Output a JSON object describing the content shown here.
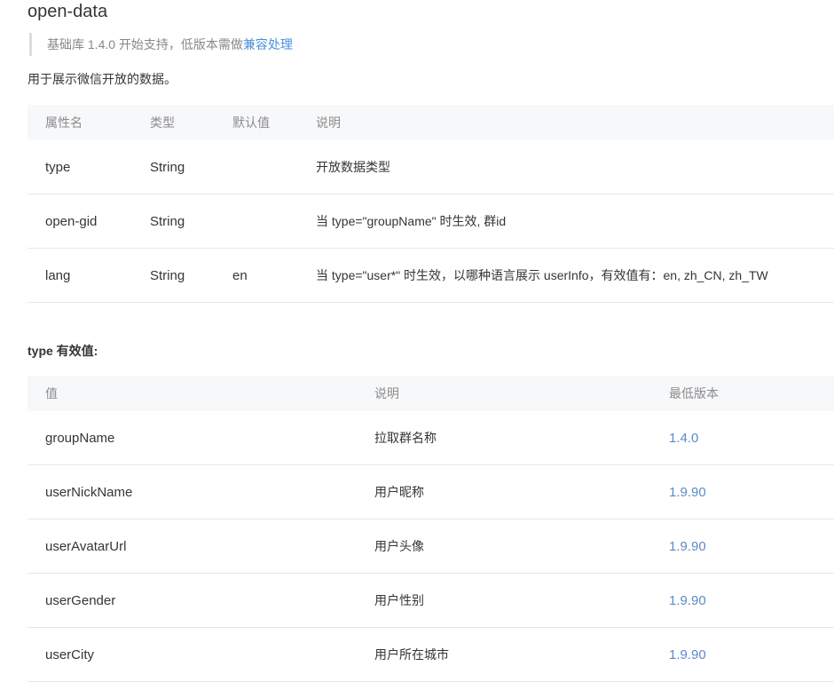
{
  "title": "open-data",
  "note": {
    "prefix": "基础库 1.4.0 开始支持，低版本需做",
    "link": "兼容处理"
  },
  "description": "用于展示微信开放的数据。",
  "attr_table": {
    "headers": [
      "属性名",
      "类型",
      "默认值",
      "说明"
    ],
    "rows": [
      {
        "name": "type",
        "type": "String",
        "default": "",
        "desc": "开放数据类型"
      },
      {
        "name": "open-gid",
        "type": "String",
        "default": "",
        "desc": "当 type=\"groupName\" 时生效, 群id"
      },
      {
        "name": "lang",
        "type": "String",
        "default": "en",
        "desc": "当 type=\"user*\" 时生效，以哪种语言展示 userInfo，有效值有：en, zh_CN, zh_TW"
      }
    ]
  },
  "type_section": {
    "heading": "type 有效值:"
  },
  "type_table": {
    "headers": [
      "值",
      "说明",
      "最低版本"
    ],
    "rows": [
      {
        "value": "groupName",
        "desc": "拉取群名称",
        "version": "1.4.0"
      },
      {
        "value": "userNickName",
        "desc": "用户昵称",
        "version": "1.9.90"
      },
      {
        "value": "userAvatarUrl",
        "desc": "用户头像",
        "version": "1.9.90"
      },
      {
        "value": "userGender",
        "desc": "用户性别",
        "version": "1.9.90"
      },
      {
        "value": "userCity",
        "desc": "用户所在城市",
        "version": "1.9.90"
      }
    ]
  },
  "colors": {
    "link": "#4a90d9",
    "version": "#5b8ac7",
    "header_bg": "#f7f8fa"
  }
}
